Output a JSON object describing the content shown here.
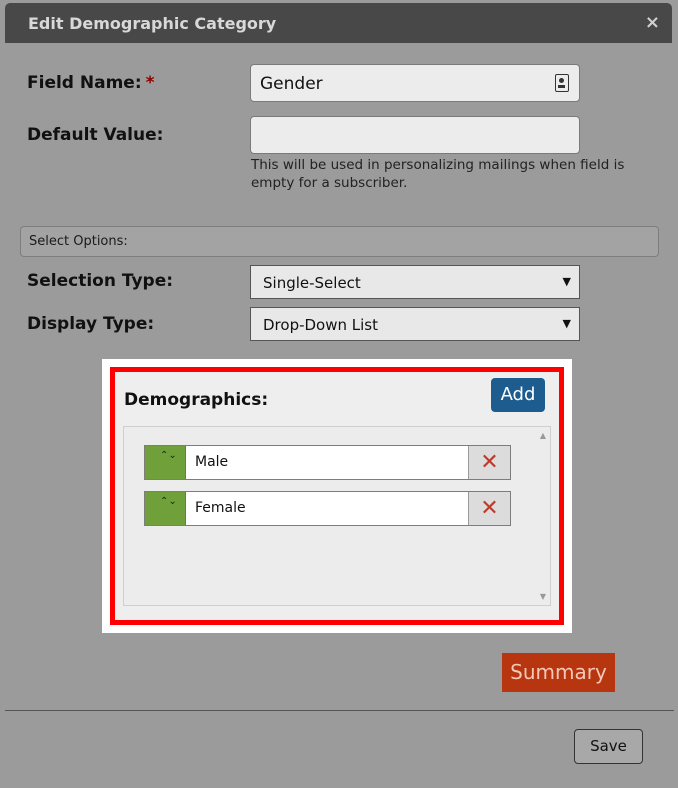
{
  "dialog": {
    "title": "Edit Demographic Category",
    "close_icon": "×"
  },
  "form": {
    "field_name_label": "Field Name:",
    "required_marker": "*",
    "field_name_value": "Gender",
    "default_value_label": "Default Value:",
    "default_value_value": "",
    "default_value_hint": "This will be used in personalizing mailings when field is empty for a subscriber.",
    "section_title": "Select Options:",
    "selection_type_label": "Selection Type:",
    "selection_type_value": "Single-Select",
    "display_type_label": "Display Type:",
    "display_type_value": "Drop-Down List"
  },
  "demographics": {
    "title": "Demographics:",
    "add_label": "Add",
    "items": [
      {
        "label": "Male"
      },
      {
        "label": "Female"
      }
    ]
  },
  "summary_label": "Summary",
  "save_label": "Save",
  "icons": {
    "drag_handle": "⌃⌄",
    "remove": "✕",
    "dropdown_arrow": "▼",
    "scroll_up": "▲",
    "scroll_down": "▼"
  },
  "colors": {
    "add_button": "#1c5c8e",
    "summary_button": "#b8360f",
    "drag_handle": "#70a03a",
    "highlight_border": "#ff0000"
  }
}
